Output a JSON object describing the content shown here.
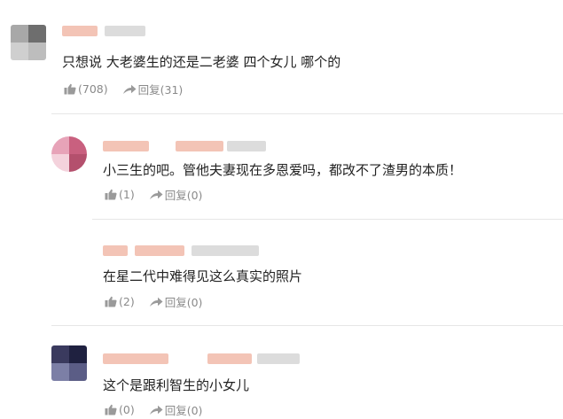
{
  "comments": [
    {
      "text": "只想说 大老婆生的还是二老婆 四个女儿 哪个的",
      "likes": "(708)",
      "reply": "回复(31)",
      "avatar_colors": [
        "#9a9a9a",
        "#6e6e6e",
        "#c8c8c8",
        "#bdbdbd"
      ]
    },
    {
      "text": "小三生的吧。管他夫妻现在多恩爱吗，都改不了渣男的本质！",
      "likes": "(1)",
      "reply": "回复(0)",
      "avatar_colors": [
        "#e7a3b8",
        "#c9607f",
        "#f4d2dc",
        "#b4506d"
      ]
    },
    {
      "text": "在星二代中难得见这么真实的照片",
      "likes": "(2)",
      "reply": "回复(0)"
    },
    {
      "text": "这个是跟利智生的小女儿",
      "likes": "(0)",
      "reply": "回复(0)",
      "avatar_colors": [
        "#3a3a5e",
        "#1f2140",
        "#7c7fa6",
        "#5b5d86"
      ]
    }
  ],
  "colors": {
    "action_gray": "#8a8a8a",
    "username_blur": "#f3c4b6",
    "time_blur": "#dcdcdc",
    "divider": "#e6e6e6"
  },
  "icons": [
    "thumbs-up-icon",
    "reply-arrow-icon"
  ]
}
